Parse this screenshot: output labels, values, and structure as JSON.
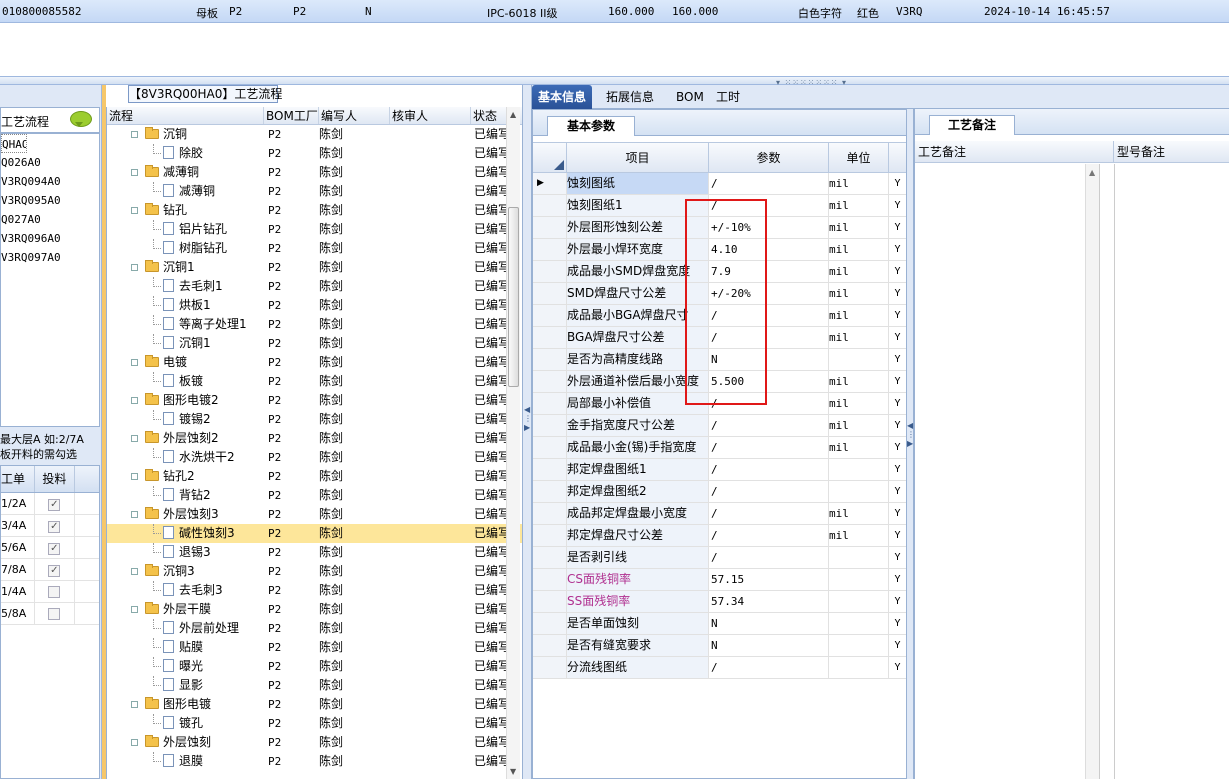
{
  "topbar": {
    "order_no": "010800085582",
    "board_label": "母板",
    "board_val": "P2",
    "f3": "P2",
    "f4": "N",
    "standard": "IPC-6018 II级",
    "n1": "160.000",
    "n2": "160.000",
    "silk": "白色字符",
    "mask": "红色",
    "ver": "V3RQ",
    "datetime": "2024-10-14 16:45:57"
  },
  "left": {
    "title": "工艺流程",
    "items": [
      "QHAO",
      "Q026A0",
      "V3RQ094A0",
      "V3RQ095A0",
      "Q027A0",
      "V3RQ096A0",
      "V3RQ097A0"
    ],
    "note_line1": "最大层A 如:2/7A",
    "note_line2": "板开料的需勾选",
    "table_headers": [
      "工单",
      "投料"
    ],
    "rows": [
      {
        "order": "1/2A",
        "checked": "✓"
      },
      {
        "order": "3/4A",
        "checked": "✓"
      },
      {
        "order": "5/6A",
        "checked": "✓"
      },
      {
        "order": "7/8A",
        "checked": "✓"
      },
      {
        "order": "1/4A",
        "checked": ""
      },
      {
        "order": "5/8A",
        "checked": ""
      }
    ]
  },
  "middle": {
    "title": "【8V3RQ00HA0】工艺流程",
    "headers": [
      "流程",
      "BOM工厂",
      "编写人",
      "核审人",
      "状态"
    ],
    "rows": [
      {
        "name": "沉铜",
        "type": "folder",
        "lvl": 0,
        "bom": "P2",
        "writer": "陈剑",
        "status": "已编写"
      },
      {
        "name": "除胶",
        "type": "doc",
        "lvl": 1,
        "bom": "P2",
        "writer": "陈剑",
        "status": "已编写"
      },
      {
        "name": "减薄铜",
        "type": "folder",
        "lvl": 0,
        "bom": "P2",
        "writer": "陈剑",
        "status": "已编写"
      },
      {
        "name": "减薄铜",
        "type": "doc",
        "lvl": 1,
        "bom": "P2",
        "writer": "陈剑",
        "status": "已编写"
      },
      {
        "name": "钻孔",
        "type": "folder",
        "lvl": 0,
        "bom": "P2",
        "writer": "陈剑",
        "status": "已编写"
      },
      {
        "name": "铝片钻孔",
        "type": "doc",
        "lvl": 1,
        "bom": "P2",
        "writer": "陈剑",
        "status": "已编写"
      },
      {
        "name": "树脂钻孔",
        "type": "doc",
        "lvl": 1,
        "bom": "P2",
        "writer": "陈剑",
        "status": "已编写"
      },
      {
        "name": "沉铜1",
        "type": "folder",
        "lvl": 0,
        "bom": "P2",
        "writer": "陈剑",
        "status": "已编写"
      },
      {
        "name": "去毛刺1",
        "type": "doc",
        "lvl": 1,
        "bom": "P2",
        "writer": "陈剑",
        "status": "已编写"
      },
      {
        "name": "烘板1",
        "type": "doc",
        "lvl": 1,
        "bom": "P2",
        "writer": "陈剑",
        "status": "已编写"
      },
      {
        "name": "等离子处理1",
        "type": "doc",
        "lvl": 1,
        "bom": "P2",
        "writer": "陈剑",
        "status": "已编写"
      },
      {
        "name": "沉铜1",
        "type": "doc",
        "lvl": 1,
        "bom": "P2",
        "writer": "陈剑",
        "status": "已编写"
      },
      {
        "name": "电镀",
        "type": "folder",
        "lvl": 0,
        "bom": "P2",
        "writer": "陈剑",
        "status": "已编写"
      },
      {
        "name": "板镀",
        "type": "doc",
        "lvl": 1,
        "bom": "P2",
        "writer": "陈剑",
        "status": "已编写"
      },
      {
        "name": "图形电镀2",
        "type": "folder",
        "lvl": 0,
        "bom": "P2",
        "writer": "陈剑",
        "status": "已编写"
      },
      {
        "name": "镀锡2",
        "type": "doc",
        "lvl": 1,
        "bom": "P2",
        "writer": "陈剑",
        "status": "已编写"
      },
      {
        "name": "外层蚀刻2",
        "type": "folder",
        "lvl": 0,
        "bom": "P2",
        "writer": "陈剑",
        "status": "已编写"
      },
      {
        "name": "水洗烘干2",
        "type": "doc",
        "lvl": 1,
        "bom": "P2",
        "writer": "陈剑",
        "status": "已编写"
      },
      {
        "name": "钻孔2",
        "type": "folder",
        "lvl": 0,
        "bom": "P2",
        "writer": "陈剑",
        "status": "已编写"
      },
      {
        "name": "背钻2",
        "type": "doc",
        "lvl": 1,
        "bom": "P2",
        "writer": "陈剑",
        "status": "已编写"
      },
      {
        "name": "外层蚀刻3",
        "type": "folder",
        "lvl": 0,
        "bom": "P2",
        "writer": "陈剑",
        "status": "已编写"
      },
      {
        "name": "碱性蚀刻3",
        "type": "doc",
        "lvl": 1,
        "bom": "P2",
        "writer": "陈剑",
        "status": "已编写",
        "selected": true
      },
      {
        "name": "退锡3",
        "type": "doc",
        "lvl": 1,
        "bom": "P2",
        "writer": "陈剑",
        "status": "已编写"
      },
      {
        "name": "沉铜3",
        "type": "folder",
        "lvl": 0,
        "bom": "P2",
        "writer": "陈剑",
        "status": "已编写"
      },
      {
        "name": "去毛刺3",
        "type": "doc",
        "lvl": 1,
        "bom": "P2",
        "writer": "陈剑",
        "status": "已编写"
      },
      {
        "name": "外层干膜",
        "type": "folder",
        "lvl": 0,
        "bom": "P2",
        "writer": "陈剑",
        "status": "已编写"
      },
      {
        "name": "外层前处理",
        "type": "doc",
        "lvl": 1,
        "bom": "P2",
        "writer": "陈剑",
        "status": "已编写"
      },
      {
        "name": "贴膜",
        "type": "doc",
        "lvl": 1,
        "bom": "P2",
        "writer": "陈剑",
        "status": "已编写"
      },
      {
        "name": "曝光",
        "type": "doc",
        "lvl": 1,
        "bom": "P2",
        "writer": "陈剑",
        "status": "已编写"
      },
      {
        "name": "显影",
        "type": "doc",
        "lvl": 1,
        "bom": "P2",
        "writer": "陈剑",
        "status": "已编写"
      },
      {
        "name": "图形电镀",
        "type": "folder",
        "lvl": 0,
        "bom": "P2",
        "writer": "陈剑",
        "status": "已编写"
      },
      {
        "name": "镀孔",
        "type": "doc",
        "lvl": 1,
        "bom": "P2",
        "writer": "陈剑",
        "status": "已编写"
      },
      {
        "name": "外层蚀刻",
        "type": "folder",
        "lvl": 0,
        "bom": "P2",
        "writer": "陈剑",
        "status": "已编写"
      },
      {
        "name": "退膜",
        "type": "doc",
        "lvl": 1,
        "bom": "P2",
        "writer": "陈剑",
        "status": "已编写"
      }
    ]
  },
  "right": {
    "tabs": [
      "基本信息",
      "拓展信息",
      "BOM",
      "工时"
    ],
    "basic_tab": "基本参数",
    "headers": [
      "项目",
      "参数",
      "单位"
    ],
    "params": [
      {
        "name": "蚀刻图纸",
        "value": "/",
        "unit": "mil",
        "flag": "Y"
      },
      {
        "name": "蚀刻图纸1",
        "value": "/",
        "unit": "mil",
        "flag": "Y"
      },
      {
        "name": "外层图形蚀刻公差",
        "value": "+/-10%",
        "unit": "mil",
        "flag": "Y"
      },
      {
        "name": "外层最小焊环宽度",
        "value": "4.10",
        "unit": "mil",
        "flag": "Y"
      },
      {
        "name": "成品最小SMD焊盘宽度",
        "value": "7.9",
        "unit": "mil",
        "flag": "Y"
      },
      {
        "name": "SMD焊盘尺寸公差",
        "value": "+/-20%",
        "unit": "mil",
        "flag": "Y"
      },
      {
        "name": "成品最小BGA焊盘尺寸",
        "value": "/",
        "unit": "mil",
        "flag": "Y"
      },
      {
        "name": "BGA焊盘尺寸公差",
        "value": "/",
        "unit": "mil",
        "flag": "Y"
      },
      {
        "name": "是否为高精度线路",
        "value": "N",
        "unit": "",
        "flag": "Y"
      },
      {
        "name": "外层通道补偿后最小宽度",
        "value": "5.500",
        "unit": "mil",
        "flag": "Y"
      },
      {
        "name": "局部最小补偿值",
        "value": "/",
        "unit": "mil",
        "flag": "Y"
      },
      {
        "name": "金手指宽度尺寸公差",
        "value": "/",
        "unit": "mil",
        "flag": "Y"
      },
      {
        "name": "成品最小金(锡)手指宽度",
        "value": "/",
        "unit": "mil",
        "flag": "Y"
      },
      {
        "name": "邦定焊盘图纸1",
        "value": "/",
        "unit": "",
        "flag": "Y"
      },
      {
        "name": "邦定焊盘图纸2",
        "value": "/",
        "unit": "",
        "flag": "Y"
      },
      {
        "name": "成品邦定焊盘最小宽度",
        "value": "/",
        "unit": "mil",
        "flag": "Y"
      },
      {
        "name": "邦定焊盘尺寸公差",
        "value": "/",
        "unit": "mil",
        "flag": "Y"
      },
      {
        "name": "是否剥引线",
        "value": "/",
        "unit": "",
        "flag": "Y"
      },
      {
        "name": "CS面残铜率",
        "value": "57.15",
        "unit": "",
        "flag": "Y",
        "pink": true
      },
      {
        "name": "SS面残铜率",
        "value": "57.34",
        "unit": "",
        "flag": "Y",
        "pink": true
      },
      {
        "name": "是否单面蚀刻",
        "value": "N",
        "unit": "",
        "flag": "Y"
      },
      {
        "name": "是否有缝宽要求",
        "value": "N",
        "unit": "",
        "flag": "Y"
      },
      {
        "name": "分流线图纸",
        "value": "/",
        "unit": "",
        "flag": "Y"
      }
    ],
    "current_marker": "▶",
    "notes_tab": "工艺备注",
    "notes_headers": [
      "工艺备注",
      "型号备注"
    ]
  },
  "colors": {
    "highlight": "#e01818",
    "selected_row": "#fde69a",
    "tab_active": "#2f5aa3"
  }
}
